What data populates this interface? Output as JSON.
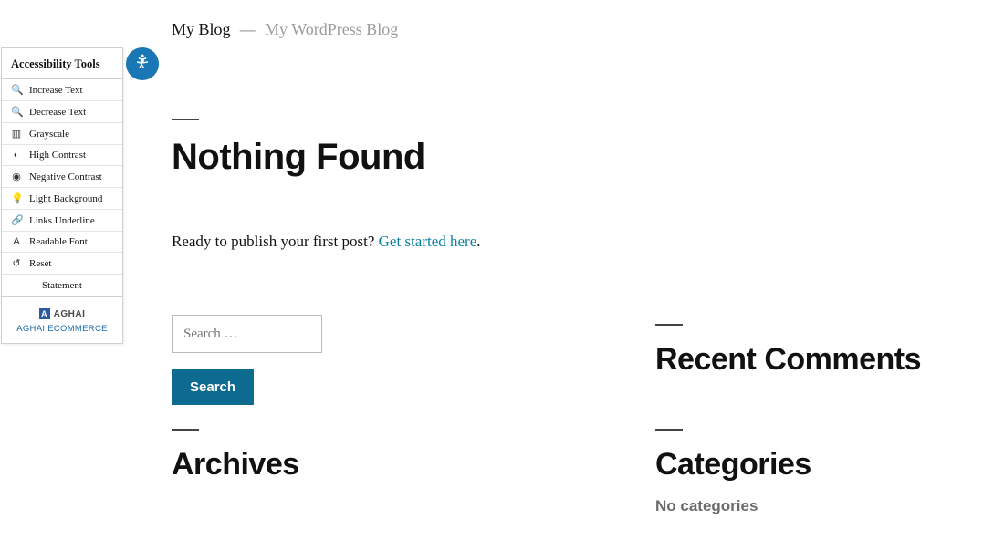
{
  "header": {
    "title": "My Blog",
    "separator": "—",
    "tagline": "My WordPress Blog"
  },
  "main": {
    "heading": "Nothing Found",
    "intro_text": "Ready to publish your first post? ",
    "intro_link": "Get started here",
    "intro_suffix": "."
  },
  "search": {
    "placeholder": "Search …",
    "button": "Search"
  },
  "widgets": {
    "recent_comments": "Recent Comments",
    "archives": "Archives",
    "categories": "Categories",
    "no_categories": "No categories"
  },
  "accessibility": {
    "title": "Accessibility Tools",
    "items": [
      {
        "icon": "🔍",
        "label": "Increase Text"
      },
      {
        "icon": "🔍",
        "label": "Decrease Text"
      },
      {
        "icon": "▥",
        "label": "Grayscale"
      },
      {
        "icon": "◐",
        "label": "High Contrast"
      },
      {
        "icon": "◉",
        "label": "Negative Contrast"
      },
      {
        "icon": "💡",
        "label": "Light Background"
      },
      {
        "icon": "🔗",
        "label": "Links Underline"
      },
      {
        "icon": "A",
        "label": "Readable Font"
      },
      {
        "icon": "↺",
        "label": "Reset"
      }
    ],
    "statement": "Statement",
    "brand_name": "AGHAI",
    "brand_link": "AGHAI ECOMMERCE"
  }
}
